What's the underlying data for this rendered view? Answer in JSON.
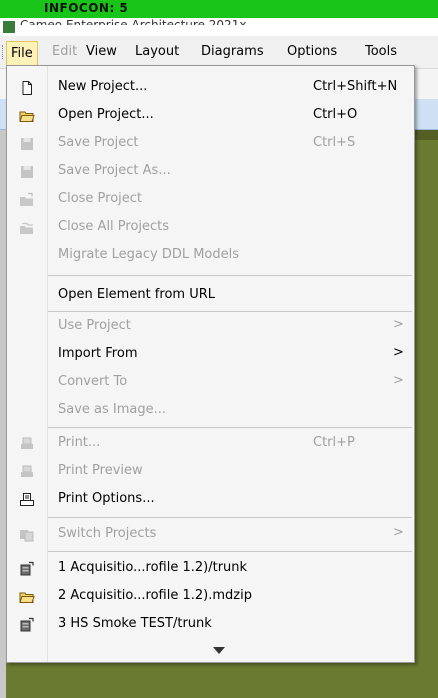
{
  "banner": {
    "text": "INFOCON: 5"
  },
  "window": {
    "title": "Cameo Enterprise Architecture 2021x"
  },
  "menubar": {
    "items": [
      {
        "label": "File",
        "state": "active"
      },
      {
        "label": "Edit",
        "state": "disabled"
      },
      {
        "label": "View",
        "state": "normal"
      },
      {
        "label": "Layout",
        "state": "normal"
      },
      {
        "label": "Diagrams",
        "state": "normal"
      },
      {
        "label": "Options",
        "state": "normal"
      },
      {
        "label": "Tools",
        "state": "normal"
      }
    ]
  },
  "file_menu": {
    "new_project": {
      "label": "New Project...",
      "shortcut": "Ctrl+Shift+N",
      "icon": "new-document-icon"
    },
    "open_project": {
      "label": "Open Project...",
      "shortcut": "Ctrl+O",
      "icon": "open-folder-icon"
    },
    "save_project": {
      "label": "Save Project",
      "shortcut": "Ctrl+S",
      "icon": "save-icon"
    },
    "save_project_as": {
      "label": "Save Project As...",
      "icon": "save-as-icon"
    },
    "close_project": {
      "label": "Close Project",
      "icon": "close-folder-icon"
    },
    "close_all_projects": {
      "label": "Close All Projects",
      "icon": "close-all-icon"
    },
    "migrate_legacy": {
      "label": "Migrate Legacy DDL Models"
    },
    "open_element_url": {
      "label": "Open Element from URL"
    },
    "use_project": {
      "label": "Use Project",
      "arrow": ">"
    },
    "import_from": {
      "label": "Import From",
      "arrow": ">"
    },
    "convert_to": {
      "label": "Convert To",
      "arrow": ">"
    },
    "save_as_image": {
      "label": "Save as Image..."
    },
    "print": {
      "label": "Print...",
      "shortcut": "Ctrl+P",
      "icon": "printer-icon"
    },
    "print_preview": {
      "label": "Print Preview",
      "icon": "print-preview-icon"
    },
    "print_options": {
      "label": "Print Options...",
      "icon": "print-options-icon"
    },
    "switch_projects": {
      "label": "Switch Projects",
      "arrow": ">",
      "icon": "switch-projects-icon"
    },
    "recent_1": {
      "label": "1 Acquisitio...rofile 1.2)/trunk",
      "icon": "server-project-icon"
    },
    "recent_2": {
      "label": "2 Acquisitio...rofile 1.2).mdzip",
      "icon": "open-folder-icon"
    },
    "recent_3": {
      "label": "3 HS Smoke TEST/trunk",
      "icon": "server-project-icon"
    },
    "more_icon": "chevron-down-icon"
  },
  "colors": {
    "banner_green": "#18c418",
    "active_menu_bg": "#fdf2b8",
    "disabled_text": "#a0a0a0",
    "workspace_olive": "#6a7a31"
  }
}
